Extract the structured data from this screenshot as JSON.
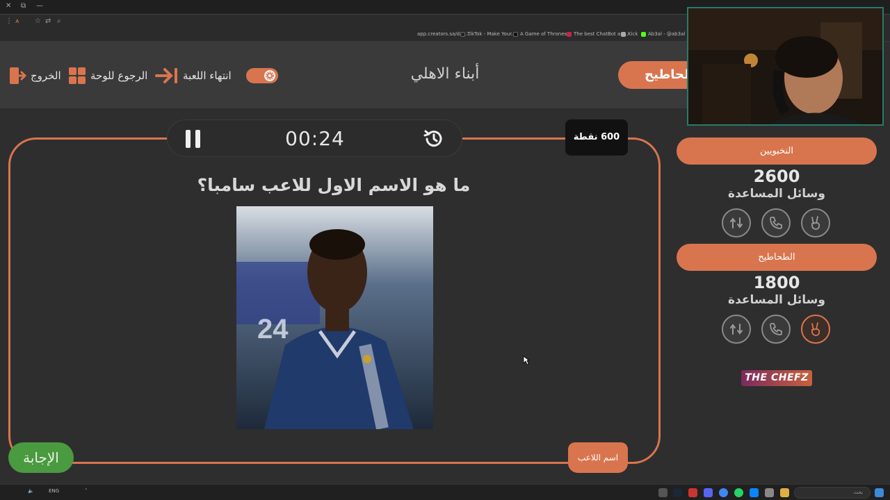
{
  "browser": {
    "bookmarks": [
      {
        "label": "app.creators.sa/das...",
        "color": "#555555"
      },
      {
        "label": "TikTok - Make Your...",
        "color": "#111111"
      },
      {
        "label": "A Game of Thrones...",
        "color": "#222222"
      },
      {
        "label": "The best ChatBot an...",
        "color": "#cc2244"
      },
      {
        "label": "Kick",
        "color": "#aaaaaa"
      },
      {
        "label": "Ab3al - @ab3al |...",
        "color": "#53fc18"
      }
    ]
  },
  "header": {
    "exit_label": "الخروج",
    "back_label": "الرجوع للوحة",
    "end_game_label": "انتهاء اللعبة",
    "game_title": "أبناء الاهلي",
    "current_team": "الطحاطيح"
  },
  "timer": {
    "value": "00:24"
  },
  "points": "600 نقطة",
  "question": "ما هو الاسم الاول للاعب سامبا؟",
  "buttons": {
    "answer": "الإجابة",
    "player_name": "اسم اللاعب"
  },
  "teams": [
    {
      "name": "النخبويين",
      "score": "2600",
      "helpers_label": "وسائل المساعدة"
    },
    {
      "name": "الطحاطيح",
      "score": "1800",
      "helpers_label": "وسائل المساعدة"
    }
  ],
  "logo": {
    "text": "THE CHEFZ"
  },
  "colors": {
    "accent": "#d9754e",
    "answer": "#4a9a40",
    "background": "#2e2e2e"
  },
  "taskbar": {
    "lang": "ENG",
    "search_placeholder": "بحث"
  }
}
